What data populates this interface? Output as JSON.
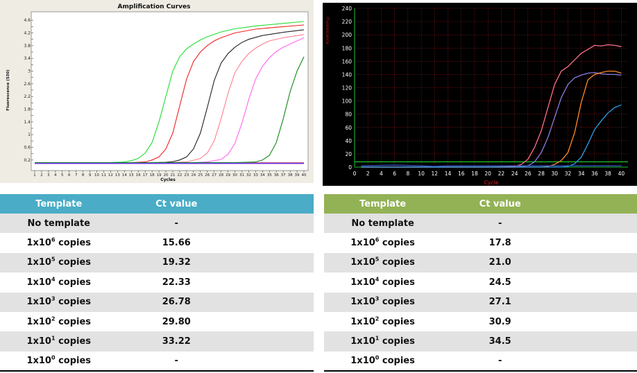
{
  "chart_data": [
    {
      "type": "line",
      "title": "Amplification Curves",
      "xlabel": "Cycles",
      "ylabel": "Fluorescence (530)",
      "xlim": [
        1,
        40
      ],
      "ylim": [
        0,
        4.8
      ],
      "x_ticks": [
        1,
        2,
        3,
        4,
        5,
        6,
        7,
        8,
        9,
        10,
        11,
        12,
        13,
        14,
        15,
        16,
        17,
        18,
        19,
        20,
        21,
        22,
        23,
        24,
        25,
        26,
        27,
        28,
        29,
        30,
        31,
        32,
        33,
        34,
        35,
        36,
        37,
        38,
        39,
        40
      ],
      "y_ticks": [
        "0.2",
        "0.4",
        "0.6",
        "0.8",
        "1",
        "1.2",
        "1.4",
        "1.6",
        "1.8",
        "2",
        "2.2",
        "2.4",
        "2.6",
        "2.8",
        "3",
        "3.2",
        "3.4",
        "3.6",
        "3.8",
        "4",
        "4.2",
        "4.4",
        "4.6"
      ],
      "y_tick_labels_shown": [
        "0.2",
        "0.6",
        "1",
        "1.4",
        "1.8",
        "2.2",
        "2.6",
        "3",
        "3.4",
        "3.8",
        "4.2",
        "4.6"
      ],
      "grid": false,
      "baseline": 0.12,
      "series": [
        {
          "color": "#22dd33",
          "x": [
            1,
            8,
            12,
            14,
            15,
            16,
            17,
            18,
            19,
            20,
            21,
            22,
            23,
            24,
            25,
            26,
            28,
            30,
            33,
            36,
            40
          ],
          "y": [
            0.12,
            0.12,
            0.12,
            0.14,
            0.18,
            0.25,
            0.42,
            0.75,
            1.4,
            2.2,
            3.0,
            3.45,
            3.7,
            3.85,
            3.98,
            4.08,
            4.23,
            4.33,
            4.42,
            4.48,
            4.56
          ]
        },
        {
          "color": "#ee2222",
          "x": [
            1,
            15,
            17,
            18,
            19,
            20,
            21,
            22,
            23,
            24,
            25,
            26,
            27,
            28,
            30,
            33,
            36,
            40
          ],
          "y": [
            0.12,
            0.12,
            0.14,
            0.2,
            0.3,
            0.55,
            1.05,
            1.9,
            2.75,
            3.3,
            3.6,
            3.8,
            3.95,
            4.05,
            4.2,
            4.32,
            4.38,
            4.45
          ]
        },
        {
          "color": "#222222",
          "x": [
            1,
            18,
            20,
            21,
            22,
            23,
            24,
            25,
            26,
            27,
            28,
            29,
            30,
            31,
            32,
            34,
            37,
            40
          ],
          "y": [
            0.12,
            0.12,
            0.13,
            0.15,
            0.2,
            0.3,
            0.55,
            1.05,
            1.85,
            2.7,
            3.25,
            3.55,
            3.75,
            3.9,
            4.0,
            4.12,
            4.22,
            4.3
          ]
        },
        {
          "color": "#ff7f8f",
          "x": [
            1,
            20,
            23,
            25,
            26,
            27,
            28,
            29,
            30,
            31,
            32,
            33,
            34,
            35,
            37,
            40
          ],
          "y": [
            0.12,
            0.12,
            0.14,
            0.25,
            0.42,
            0.8,
            1.5,
            2.3,
            2.95,
            3.3,
            3.55,
            3.72,
            3.85,
            3.95,
            4.05,
            4.15
          ]
        },
        {
          "color": "#ff66ee",
          "x": [
            1,
            24,
            26,
            28,
            29,
            30,
            31,
            32,
            33,
            34,
            35,
            36,
            37,
            38,
            39,
            40
          ],
          "y": [
            0.12,
            0.12,
            0.14,
            0.22,
            0.38,
            0.72,
            1.35,
            2.1,
            2.75,
            3.15,
            3.42,
            3.62,
            3.75,
            3.85,
            3.95,
            4.05
          ]
        },
        {
          "color": "#118811",
          "x": [
            1,
            30,
            33,
            34,
            35,
            36,
            37,
            38,
            39,
            40
          ],
          "y": [
            0.12,
            0.12,
            0.14,
            0.2,
            0.35,
            0.75,
            1.5,
            2.35,
            3.0,
            3.45
          ]
        },
        {
          "color": "#3355ff",
          "x": [
            1,
            10,
            20,
            30,
            40
          ],
          "y": [
            0.1,
            0.1,
            0.1,
            0.1,
            0.1
          ]
        },
        {
          "color": "#8a2be2",
          "x": [
            1,
            10,
            20,
            30,
            40
          ],
          "y": [
            0.09,
            0.09,
            0.09,
            0.09,
            0.09
          ]
        }
      ]
    },
    {
      "type": "line",
      "title": "",
      "xlabel": "Cycle",
      "ylabel": "Fluorescence",
      "xlim": [
        0,
        41
      ],
      "ylim": [
        0,
        240
      ],
      "x_ticks": [
        0,
        2,
        4,
        6,
        8,
        10,
        12,
        14,
        16,
        18,
        20,
        22,
        24,
        26,
        28,
        30,
        32,
        34,
        36,
        38,
        40
      ],
      "y_ticks": [
        0,
        20,
        40,
        60,
        80,
        100,
        120,
        140,
        160,
        180,
        200,
        220,
        240
      ],
      "grid": true,
      "threshold": 8,
      "series": [
        {
          "color": "#ff6f8a",
          "x": [
            1,
            20,
            24,
            25,
            26,
            27,
            28,
            29,
            30,
            31,
            32,
            33,
            34,
            35,
            36,
            37,
            38,
            39,
            40
          ],
          "y": [
            0,
            0,
            1,
            4,
            12,
            30,
            55,
            90,
            125,
            145,
            152,
            162,
            172,
            178,
            184,
            183,
            185,
            184,
            182
          ]
        },
        {
          "color": "#8a7ee0",
          "x": [
            1,
            24,
            26,
            27,
            28,
            29,
            30,
            31,
            32,
            33,
            34,
            35,
            36,
            37,
            38,
            39,
            40
          ],
          "y": [
            0,
            0,
            2,
            8,
            22,
            45,
            75,
            105,
            125,
            135,
            139,
            142,
            143,
            141,
            140,
            140,
            139
          ]
        },
        {
          "color": "#ff8c2a",
          "x": [
            1,
            28,
            29,
            30,
            31,
            32,
            33,
            34,
            35,
            36,
            37,
            38,
            39,
            40
          ],
          "y": [
            0,
            0,
            1,
            4,
            10,
            22,
            52,
            98,
            132,
            140,
            143,
            145,
            145,
            142
          ]
        },
        {
          "color": "#2e9ee6",
          "x": [
            1,
            31,
            32,
            33,
            34,
            35,
            36,
            37,
            38,
            39,
            40
          ],
          "y": [
            0,
            0,
            1,
            5,
            15,
            35,
            57,
            70,
            82,
            90,
            94
          ]
        },
        {
          "color": "#3355cc",
          "x": [
            1,
            6,
            10,
            12,
            14,
            40
          ],
          "y": [
            2,
            3,
            2,
            1,
            2,
            2
          ]
        }
      ]
    }
  ],
  "tables": {
    "left": {
      "headers": [
        "Template",
        "Ct value"
      ],
      "rows": [
        {
          "base": "No template",
          "exp": "",
          "suffix": "",
          "ct": "-"
        },
        {
          "base": "1x10",
          "exp": "6",
          "suffix": " copies",
          "ct": "15.66"
        },
        {
          "base": "1x10",
          "exp": "5",
          "suffix": " copies",
          "ct": "19.32"
        },
        {
          "base": "1x10",
          "exp": "4",
          "suffix": " copies",
          "ct": "22.33"
        },
        {
          "base": "1x10",
          "exp": "3",
          "suffix": " copies",
          "ct": "26.78"
        },
        {
          "base": "1x10",
          "exp": "2",
          "suffix": " copies",
          "ct": "29.80"
        },
        {
          "base": "1x10",
          "exp": "1",
          "suffix": " copies",
          "ct": "33.22"
        },
        {
          "base": "1x10",
          "exp": "0",
          "suffix": " copies",
          "ct": "-"
        }
      ]
    },
    "right": {
      "headers": [
        "Template",
        "Ct value"
      ],
      "rows": [
        {
          "base": "No template",
          "exp": "",
          "suffix": "",
          "ct": "-"
        },
        {
          "base": "1x10",
          "exp": "6",
          "suffix": " copies",
          "ct": "17.8"
        },
        {
          "base": "1x10",
          "exp": "5",
          "suffix": " copies",
          "ct": "21.0"
        },
        {
          "base": "1x10",
          "exp": "4",
          "suffix": " copies",
          "ct": "24.5"
        },
        {
          "base": "1x10",
          "exp": "3",
          "suffix": " copies",
          "ct": "27.1"
        },
        {
          "base": "1x10",
          "exp": "2",
          "suffix": " copies",
          "ct": "30.9"
        },
        {
          "base": "1x10",
          "exp": "1",
          "suffix": " copies",
          "ct": "34.5"
        },
        {
          "base": "1x10",
          "exp": "0",
          "suffix": " copies",
          "ct": "-"
        }
      ]
    }
  }
}
